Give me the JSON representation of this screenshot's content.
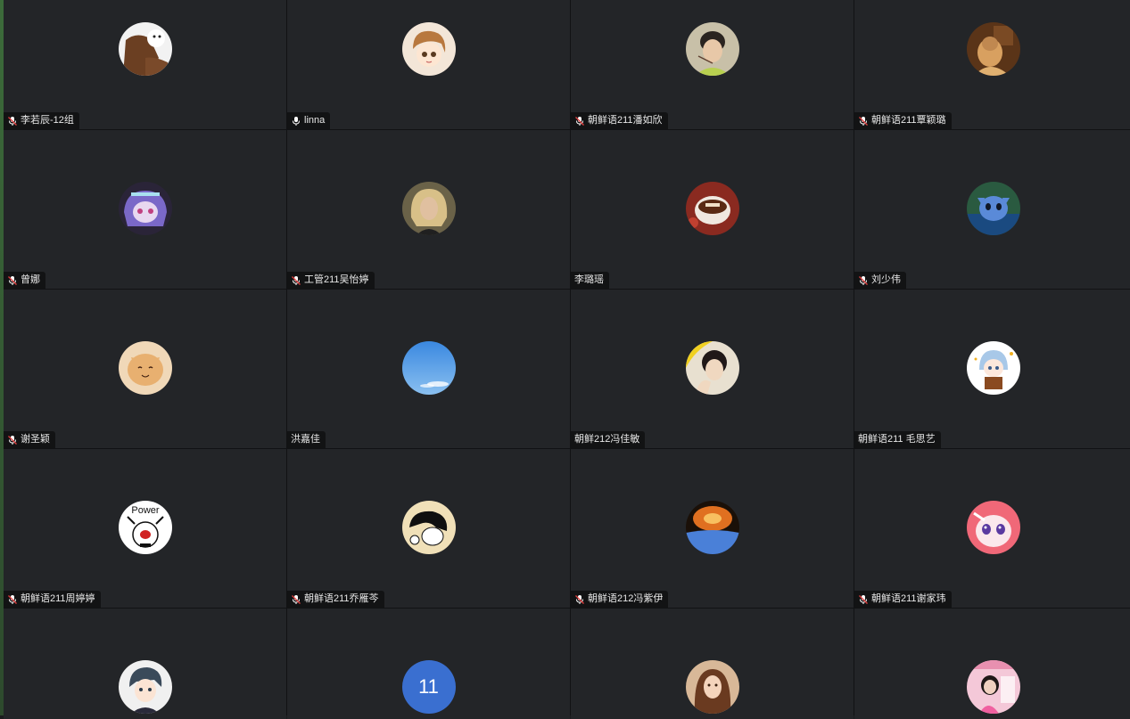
{
  "participants": [
    {
      "name": "李若辰-12组",
      "mic": "muted",
      "avatar": "cartoon-dog-avatar",
      "color": "#7a4a2a"
    },
    {
      "name": "linna",
      "mic": "on",
      "avatar": "anime-girl-avatar",
      "color": "#c9915a"
    },
    {
      "name": "朝鲜语211潘如欣",
      "mic": "muted",
      "avatar": "photo-avatar",
      "color": "#9aa48a"
    },
    {
      "name": "朝鲜语211覃颖璐",
      "mic": "muted",
      "avatar": "photo-avatar",
      "color": "#b07838"
    },
    {
      "name": "曾娜",
      "mic": "muted",
      "avatar": "anime-character-avatar",
      "color": "#5a4aa0"
    },
    {
      "name": "工管211吴怡婷",
      "mic": "muted",
      "avatar": "portrait-avatar",
      "color": "#8a7a58"
    },
    {
      "name": "李璐瑶",
      "mic": "none",
      "avatar": "coffee-cup-avatar",
      "color": "#a04030"
    },
    {
      "name": "刘少伟",
      "mic": "muted",
      "avatar": "stitch-avatar",
      "color": "#3a7ab8"
    },
    {
      "name": "谢圣颖",
      "mic": "muted",
      "avatar": "cat-avatar",
      "color": "#e0b080"
    },
    {
      "name": "洪嘉佳",
      "mic": "none",
      "avatar": "sky-avatar",
      "color": "#5a9ee8"
    },
    {
      "name": "朝鲜212冯佳敏",
      "mic": "none",
      "avatar": "selfie-avatar",
      "color": "#c8b040"
    },
    {
      "name": "朝鲜语211 毛思艺",
      "mic": "none",
      "avatar": "chibi-avatar",
      "color": "#a8c8e8"
    },
    {
      "name": "朝鲜语211周婷婷",
      "mic": "muted",
      "avatar": "power-sticker-avatar",
      "color": "#f0f0f0"
    },
    {
      "name": "朝鲜语211乔雁芩",
      "mic": "muted",
      "avatar": "sketch-avatar",
      "color": "#e8d8b0"
    },
    {
      "name": "朝鲜语212冯紫伊",
      "mic": "muted",
      "avatar": "sunset-avatar",
      "color": "#d86a20"
    },
    {
      "name": "朝鲜语211谢家玮",
      "mic": "muted",
      "avatar": "anime-eyes-avatar",
      "color": "#f08090"
    },
    {
      "name": "",
      "mic": "hidden",
      "avatar": "anime-boy-avatar",
      "color": "#d8d8d8"
    },
    {
      "name": "",
      "mic": "hidden",
      "avatar": "number-avatar",
      "avatar_text": "11",
      "color": "#3a6fd0"
    },
    {
      "name": "",
      "mic": "hidden",
      "avatar": "girl-photo-avatar",
      "color": "#c09070"
    },
    {
      "name": "",
      "mic": "hidden",
      "avatar": "pink-photo-avatar",
      "color": "#e8a0b8"
    }
  ],
  "colors": {
    "tile_bg": "#232528",
    "nameplate_bg": "#121314",
    "muted_icon": "#ffffff"
  }
}
